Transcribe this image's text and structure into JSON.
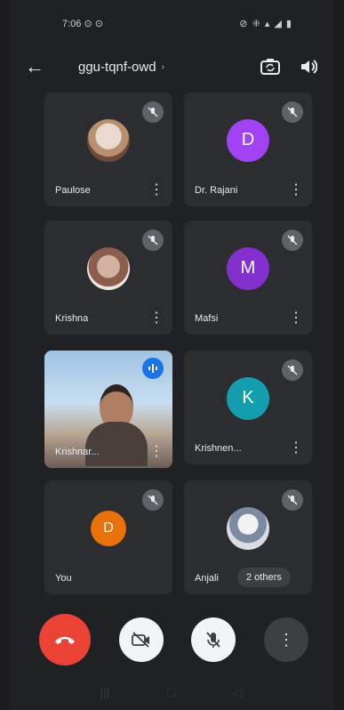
{
  "status_bar": {
    "time": "7:06 ⊙ ⊙",
    "icons": "⊘ ⁜ ▴ ◢ ▮"
  },
  "app_bar": {
    "back_icon": "arrow-left-icon",
    "meeting_code": "ggu-tqnf-owd",
    "caret": "›"
  },
  "participants": [
    {
      "name": "Paulose",
      "avatar": "photo",
      "muted": true
    },
    {
      "name": "Dr. Rajani",
      "initial": "D",
      "color": "#a142f4",
      "muted": true
    },
    {
      "name": "Krishna",
      "avatar": "photo2",
      "muted": true
    },
    {
      "name": "Mafsi",
      "initial": "M",
      "color": "#8430ce",
      "muted": true
    },
    {
      "name": "Krishnar...",
      "video": true,
      "speaking": true
    },
    {
      "name": "Krishnen...",
      "initial": "K",
      "color": "#129eaf",
      "muted": true
    },
    {
      "name": "You",
      "initial": "D",
      "color": "#e8710a",
      "muted": true
    },
    {
      "name": "Anjali",
      "avatar": "photo3",
      "muted": true,
      "others_label": "2 others"
    }
  ],
  "menu_glyph": "⋮",
  "controls": {
    "end_call": "end-call-icon",
    "camera_off": "camera-off-icon",
    "mic_off": "mic-off-icon",
    "more": "⋮"
  },
  "nav": {
    "recent": "|||",
    "home": "□",
    "back": "◁"
  }
}
